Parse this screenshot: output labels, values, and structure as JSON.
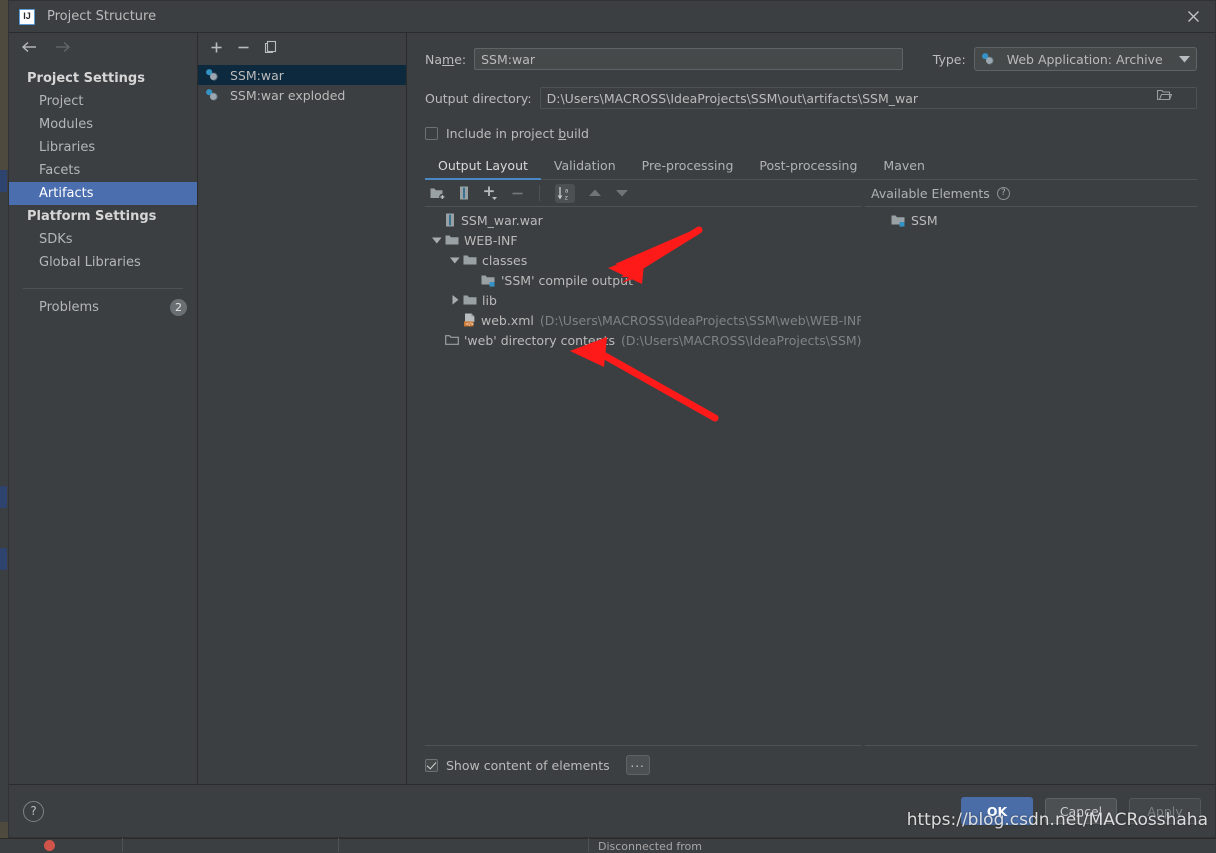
{
  "window": {
    "title": "Project Structure",
    "app_icon": "intellij-idea-icon",
    "close_icon": "close-icon"
  },
  "nav": {
    "back_icon": "arrow-left-icon",
    "forward_icon": "arrow-right-icon",
    "groups": [
      {
        "label": "Project Settings",
        "items": [
          {
            "label": "Project",
            "selected": false
          },
          {
            "label": "Modules",
            "selected": false
          },
          {
            "label": "Libraries",
            "selected": false
          },
          {
            "label": "Facets",
            "selected": false
          },
          {
            "label": "Artifacts",
            "selected": true
          }
        ]
      },
      {
        "label": "Platform Settings",
        "items": [
          {
            "label": "SDKs",
            "selected": false
          },
          {
            "label": "Global Libraries",
            "selected": false
          }
        ]
      }
    ],
    "problems": {
      "label": "Problems",
      "count": "2"
    }
  },
  "artifacts": {
    "toolbar": [
      {
        "name": "add-artifact-button",
        "icon": "plus-icon"
      },
      {
        "name": "remove-artifact-button",
        "icon": "minus-icon"
      },
      {
        "name": "copy-artifact-button",
        "icon": "copy-icon"
      }
    ],
    "items": [
      {
        "label": "SSM:war",
        "icon": "web-archive-icon",
        "selected": true
      },
      {
        "label": "SSM:war exploded",
        "icon": "web-exploded-icon",
        "selected": false
      }
    ]
  },
  "editor": {
    "name_label": "Name:",
    "name_value": "SSM:war",
    "type_label": "Type:",
    "type_value": "Web Application: Archive",
    "type_icon": "web-archive-icon",
    "type_dropdown_icon": "chevron-down-icon",
    "output_label": "Output directory:",
    "output_value": "D:\\Users\\MACROSS\\IdeaProjects\\SSM\\out\\artifacts\\SSM_war",
    "browse_icon": "folder-open-icon",
    "include_in_build": {
      "label": "Include in project build",
      "checked": false
    },
    "tabs": [
      {
        "label": "Output Layout",
        "active": true
      },
      {
        "label": "Validation",
        "active": false
      },
      {
        "label": "Pre-processing",
        "active": false
      },
      {
        "label": "Post-processing",
        "active": false
      },
      {
        "label": "Maven",
        "active": false
      }
    ],
    "layout_toolbar": [
      {
        "name": "add-directory-button",
        "icon": "add-folder-icon"
      },
      {
        "name": "add-archive-button",
        "icon": "add-archive-icon"
      },
      {
        "name": "add-element-button",
        "icon": "plus-dropdown-icon"
      },
      {
        "name": "remove-element-button",
        "icon": "minus-icon"
      },
      {
        "name": "sort-elements-button",
        "icon": "sort-az-icon"
      },
      {
        "name": "move-up-button",
        "icon": "arrow-up-icon"
      },
      {
        "name": "move-down-button",
        "icon": "arrow-down-icon"
      }
    ],
    "tree": [
      {
        "label": "SSM_war.war",
        "sub": "",
        "icon": "archive-icon",
        "indent": 0,
        "twisty": "none"
      },
      {
        "label": "WEB-INF",
        "sub": "",
        "icon": "folder-icon",
        "indent": 1,
        "twisty": "expanded"
      },
      {
        "label": "classes",
        "sub": "",
        "icon": "folder-icon",
        "indent": 2,
        "twisty": "expanded"
      },
      {
        "label": "'SSM' compile output",
        "sub": "",
        "icon": "compile-output-icon",
        "indent": 3,
        "twisty": "none"
      },
      {
        "label": "lib",
        "sub": "",
        "icon": "folder-icon",
        "indent": 2,
        "twisty": "collapsed"
      },
      {
        "label": "web.xml",
        "sub": "(D:\\Users\\MACROSS\\IdeaProjects\\SSM\\web\\WEB-INF)",
        "icon": "xml-file-icon",
        "indent": 2,
        "twisty": "none"
      },
      {
        "label": "'web' directory contents",
        "sub": "(D:\\Users\\MACROSS\\IdeaProjects\\SSM)",
        "icon": "directory-contents-icon",
        "indent": 1,
        "twisty": "none"
      }
    ],
    "available": {
      "title": "Available Elements",
      "help_icon": "question-mark-icon",
      "items": [
        {
          "label": "SSM",
          "icon": "compile-output-icon",
          "indent": 1
        }
      ]
    },
    "show_content": {
      "label": "Show content of elements",
      "checked": true
    },
    "ellipsis_button": "..."
  },
  "footer": {
    "help_icon": "question-mark-icon",
    "help_label": "?",
    "ok_label": "OK",
    "cancel_label": "Cancel",
    "apply_label": "Apply"
  },
  "watermark": "https://blog.csdn.net/MACRosshaha",
  "backdrop": {
    "status_text": "Disconnected from",
    "error_icon": "error-dot-icon"
  },
  "colors": {
    "accent_blue": "#4b6eaf",
    "tab_underline": "#4a88c7",
    "selection_dark": "#0d293e",
    "panel_bg": "#3c3f41",
    "annotation_red": "#ff1a1a"
  }
}
